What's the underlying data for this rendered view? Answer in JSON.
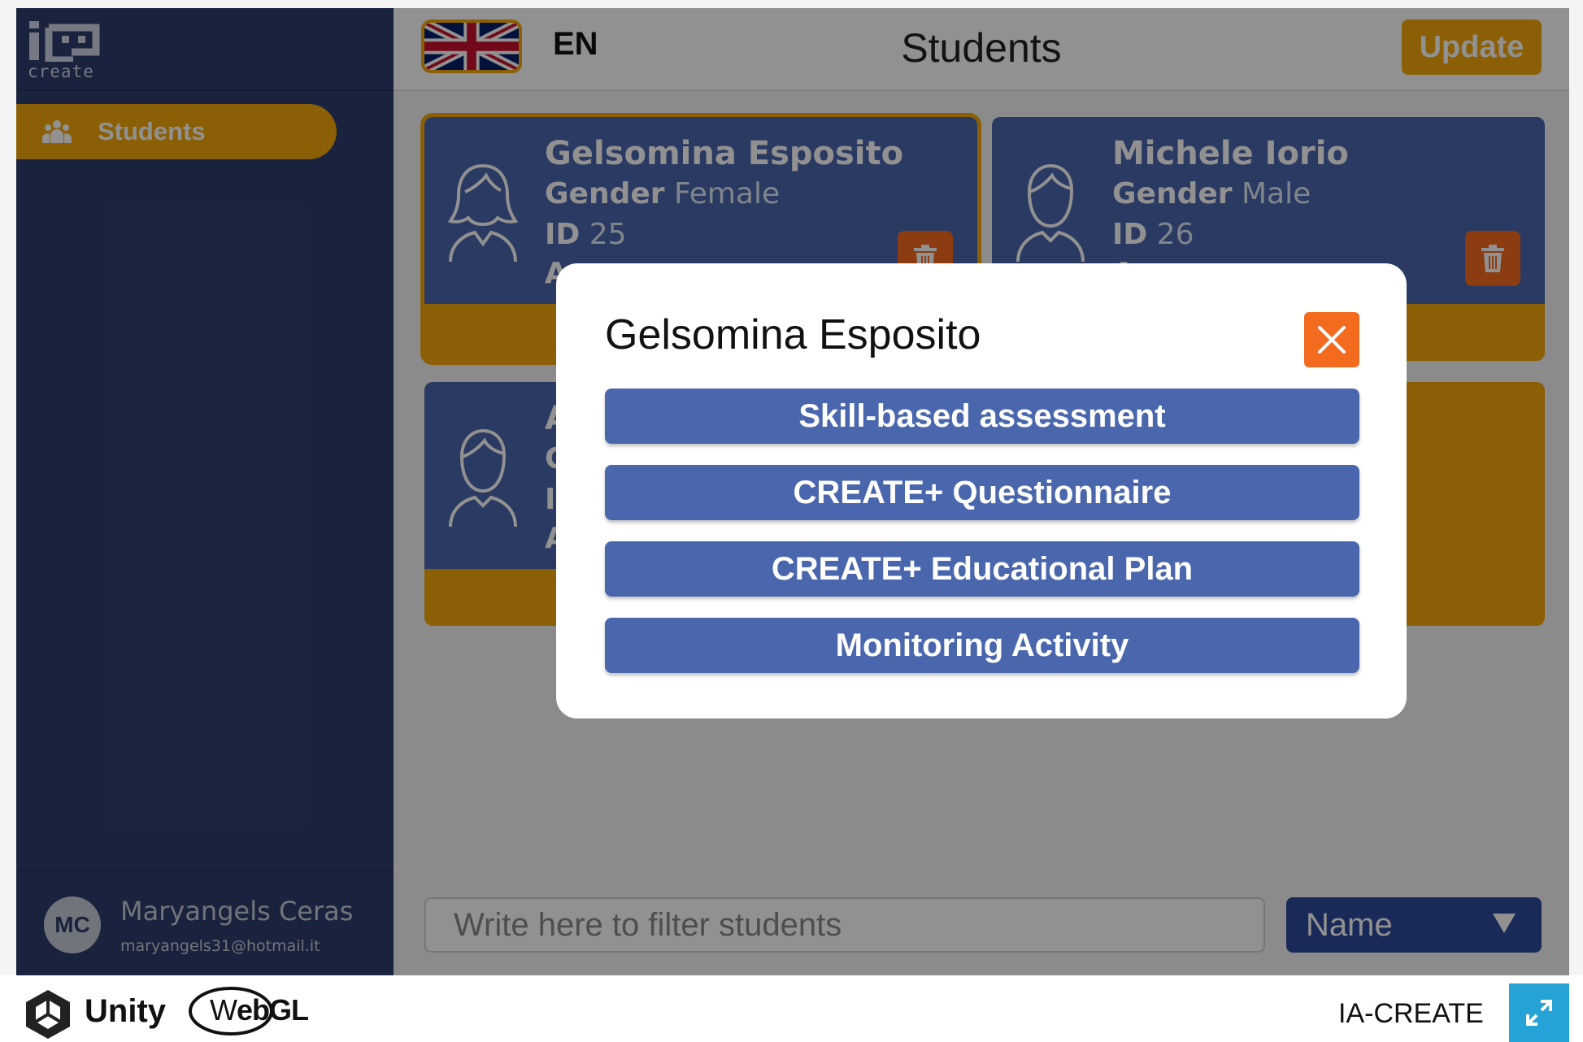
{
  "app": {
    "logo_text": "create",
    "language": "EN",
    "page_title": "Students",
    "update_label": "Update"
  },
  "sidebar": {
    "items": [
      {
        "label": "Students",
        "icon": "group-icon",
        "active": true
      }
    ],
    "user": {
      "initials": "MC",
      "name": "Maryangels Ceras",
      "email": "maryangels31@hotmail.it"
    }
  },
  "students": [
    {
      "name": "Gelsomina Esposito",
      "gender_label": "Gender",
      "gender": "Female",
      "id_label": "ID",
      "id": "25",
      "age_label": "A",
      "avatar": "female-person-icon"
    },
    {
      "name": "Michele Iorio",
      "gender_label": "Gender",
      "gender": "Male",
      "id_label": "ID",
      "id": "26",
      "age_label": "A",
      "avatar": "male-person-icon"
    },
    {
      "name": "A",
      "gender_label": "G",
      "id_label": "I",
      "age_label": "A",
      "avatar": "male-person-icon"
    }
  ],
  "filter": {
    "placeholder": "Write here to filter students",
    "sort_selected": "Name"
  },
  "modal": {
    "title": "Gelsomina Esposito",
    "options": [
      "Skill-based assessment",
      "CREATE+ Questionnaire",
      "CREATE+ Educational Plan",
      "Monitoring Activity"
    ]
  },
  "footer": {
    "engine": "Unity",
    "platform_prefix": "W",
    "platform_rest": "ebGL",
    "app_name": "IA-CREATE"
  },
  "colors": {
    "sidebar": "#2e3f6c",
    "accent": "#f5a80b",
    "card": "#4a67ad",
    "danger": "#f46a1f",
    "sort": "#2e4a9c",
    "fullscreen": "#25a3d6"
  }
}
